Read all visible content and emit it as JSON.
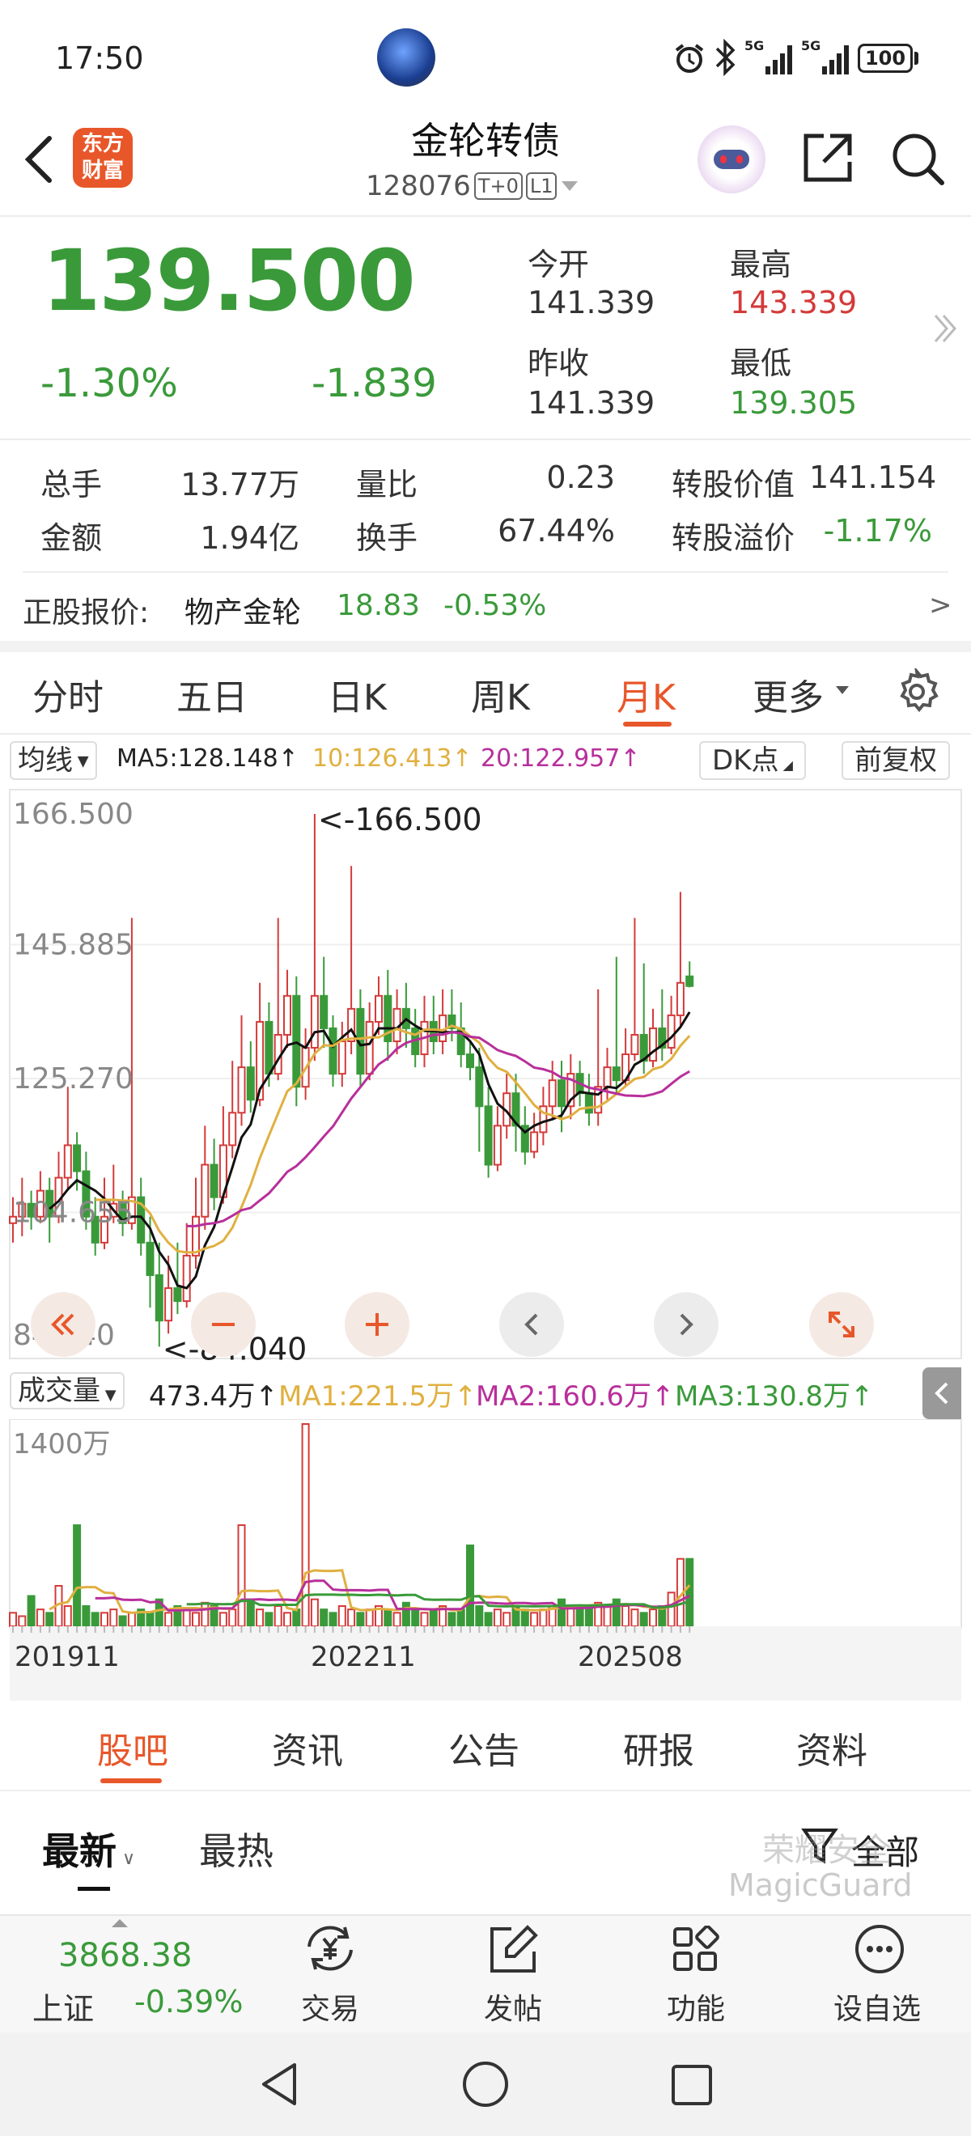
{
  "status": {
    "time": "17:50",
    "battery": "100",
    "network": "5G"
  },
  "header": {
    "title": "金轮转债",
    "code": "128076",
    "badge1": "T+0",
    "badge2": "L1",
    "logo_l1": "东方",
    "logo_l2": "财富"
  },
  "quote": {
    "price": "139.500",
    "pct": "-1.30%",
    "chg": "-1.839",
    "open_label": "今开",
    "open": "141.339",
    "high_label": "最高",
    "high": "143.339",
    "prev_label": "昨收",
    "prev": "141.339",
    "low_label": "最低",
    "low": "139.305"
  },
  "stats": {
    "vol_label": "总手",
    "vol": "13.77万",
    "ratio_label": "量比",
    "ratio": "0.23",
    "convval_label": "转股价值",
    "convval": "141.154",
    "amt_label": "金额",
    "amt": "1.94亿",
    "turn_label": "换手",
    "turn": "67.44%",
    "prem_label": "转股溢价",
    "prem": "-1.17%"
  },
  "stock": {
    "label": "正股报价:",
    "name": "物产金轮",
    "price": "18.83",
    "pct": "-0.53%",
    "arrow": ">"
  },
  "tabs": [
    "分时",
    "五日",
    "日K",
    "周K",
    "月K",
    "更多"
  ],
  "active_tab": 4,
  "ma_bar": {
    "sel": "均线",
    "ma5": "MA5:128.148↑",
    "ma10": "10:126.413↑",
    "ma20": "20:122.957↑",
    "dk": "DK点",
    "fq": "前复权"
  },
  "chart_data": {
    "type": "candlestick",
    "y_ticks": [
      "166.500",
      "145.885",
      "125.270",
      "104.655",
      "84.040"
    ],
    "max_label": "<-166.500",
    "min_label": "<-84.040",
    "ylim": [
      84.04,
      166.5
    ],
    "volume": {
      "sel": "成交量",
      "value": "473.4万↑",
      "ma1": "MA1:221.5万↑",
      "ma2": "MA2:160.6万↑",
      "ma3": "MA3:130.8万↑",
      "y_tick": "1400万"
    },
    "x_ticks": [
      "201911",
      "202211",
      "202508"
    ],
    "candles": [
      [
        103,
        104,
        107,
        100
      ],
      [
        104,
        106,
        110,
        101
      ],
      [
        106,
        104,
        108,
        102
      ],
      [
        104,
        108,
        111,
        103
      ],
      [
        108,
        104,
        110,
        100
      ],
      [
        104,
        110,
        114,
        103
      ],
      [
        110,
        115,
        124,
        108
      ],
      [
        115,
        111,
        117,
        108
      ],
      [
        111,
        104,
        114,
        102
      ],
      [
        104,
        100,
        107,
        98
      ],
      [
        100,
        104,
        110,
        99
      ],
      [
        104,
        106,
        112,
        103
      ],
      [
        106,
        103,
        108,
        101
      ],
      [
        103,
        107,
        150,
        102
      ],
      [
        107,
        100,
        110,
        98
      ],
      [
        100,
        95,
        104,
        90
      ],
      [
        95,
        88,
        100,
        84
      ],
      [
        88,
        93,
        98,
        86
      ],
      [
        93,
        91,
        100,
        89
      ],
      [
        91,
        98,
        103,
        90
      ],
      [
        98,
        104,
        110,
        96
      ],
      [
        104,
        112,
        118,
        102
      ],
      [
        112,
        107,
        116,
        105
      ],
      [
        107,
        115,
        121,
        106
      ],
      [
        115,
        120,
        128,
        113
      ],
      [
        120,
        127,
        135,
        118
      ],
      [
        127,
        122,
        131,
        120
      ],
      [
        122,
        134,
        140,
        121
      ],
      [
        134,
        126,
        137,
        124
      ],
      [
        126,
        132,
        150,
        125
      ],
      [
        132,
        138,
        142,
        130
      ],
      [
        138,
        124,
        141,
        121
      ],
      [
        124,
        130,
        133,
        122
      ],
      [
        130,
        138,
        166,
        128
      ],
      [
        138,
        133,
        144,
        130
      ],
      [
        133,
        126,
        135,
        124
      ],
      [
        126,
        131,
        134,
        124
      ],
      [
        131,
        136,
        158,
        129
      ],
      [
        136,
        126,
        139,
        124
      ],
      [
        126,
        134,
        137,
        125
      ],
      [
        134,
        138,
        141,
        132
      ],
      [
        138,
        131,
        142,
        128
      ],
      [
        131,
        136,
        139,
        129
      ],
      [
        136,
        133,
        140,
        130
      ],
      [
        133,
        129,
        136,
        127
      ],
      [
        129,
        134,
        138,
        127
      ],
      [
        134,
        131,
        138,
        129
      ],
      [
        131,
        135,
        139,
        129
      ],
      [
        135,
        133,
        139,
        131
      ],
      [
        133,
        129,
        137,
        127
      ],
      [
        129,
        127,
        131,
        125
      ],
      [
        127,
        121,
        130,
        114
      ],
      [
        121,
        112,
        124,
        110
      ],
      [
        112,
        118,
        121,
        111
      ],
      [
        118,
        123,
        126,
        116
      ],
      [
        123,
        118,
        126,
        114
      ],
      [
        118,
        114,
        121,
        112
      ],
      [
        114,
        117,
        120,
        113
      ],
      [
        117,
        121,
        124,
        115
      ],
      [
        121,
        125,
        128,
        119
      ],
      [
        125,
        121,
        128,
        117
      ],
      [
        121,
        126,
        129,
        119
      ],
      [
        126,
        123,
        128,
        121
      ],
      [
        123,
        120,
        126,
        118
      ],
      [
        120,
        124,
        139,
        118
      ],
      [
        124,
        127,
        130,
        122
      ],
      [
        127,
        125,
        144,
        123
      ],
      [
        125,
        129,
        133,
        124
      ],
      [
        129,
        132,
        150,
        128
      ],
      [
        132,
        128,
        143,
        126
      ],
      [
        128,
        133,
        136,
        127
      ],
      [
        133,
        130,
        139,
        128
      ],
      [
        130,
        135,
        138,
        129
      ],
      [
        135,
        140,
        154,
        133
      ],
      [
        141,
        139.5,
        143.3,
        139.3
      ]
    ],
    "volumes": [
      20,
      15,
      45,
      25,
      20,
      60,
      30,
      150,
      30,
      20,
      20,
      25,
      15,
      20,
      25,
      20,
      40,
      20,
      30,
      25,
      20,
      35,
      30,
      20,
      25,
      150,
      40,
      25,
      20,
      30,
      20,
      25,
      300,
      40,
      25,
      20,
      30,
      25,
      20,
      25,
      30,
      25,
      20,
      35,
      25,
      20,
      25,
      30,
      20,
      25,
      120,
      30,
      20,
      25,
      20,
      30,
      25,
      20,
      25,
      30,
      40,
      30,
      25,
      30,
      35,
      30,
      40,
      30,
      25,
      20,
      25,
      30,
      50,
      100,
      100
    ]
  },
  "bottom_tabs": [
    "股吧",
    "资讯",
    "公告",
    "研报",
    "资料"
  ],
  "sub_tabs": {
    "latest": "最新",
    "hot": "最热",
    "all": "全部"
  },
  "watermark": {
    "l1": "荣耀安全",
    "l2": "MagicGuard"
  },
  "index": {
    "value": "3868.38",
    "name": "上证",
    "pct": "-0.39%"
  },
  "nav": [
    "交易",
    "发帖",
    "功能",
    "设自选"
  ],
  "colors": {
    "up": "#d43a3a",
    "down": "#3a9a3a",
    "accent": "#e8572a"
  }
}
